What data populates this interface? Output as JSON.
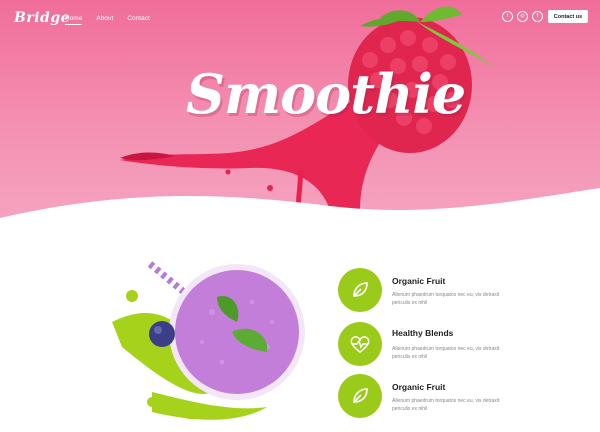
{
  "brand": {
    "logo": "Bridge"
  },
  "nav": {
    "items": [
      {
        "label": "Home",
        "active": true
      },
      {
        "label": "About",
        "active": false
      },
      {
        "label": "Contact",
        "active": false
      }
    ]
  },
  "social": [
    {
      "icon": "twitter-icon",
      "glyph": "t"
    },
    {
      "icon": "instagram-icon",
      "glyph": "◎"
    },
    {
      "icon": "facebook-icon",
      "glyph": "f"
    }
  ],
  "header": {
    "contact_button": "Contact us"
  },
  "hero": {
    "title": "Smoothie"
  },
  "features": [
    {
      "icon": "leaf-icon",
      "title": "Organic Fruit",
      "text": "Allenum phaedrum torquatos nec eu, vis detraxit periculis ex nihil"
    },
    {
      "icon": "heartbeat-icon",
      "title": "Healthy Blends",
      "text": "Allenum phaedrum torquatos nec eu, vis detraxit periculis ex nihil"
    },
    {
      "icon": "leaf-icon",
      "title": "Organic Fruit",
      "text": "Allenum phaedrum torquatos nec eu, vis detraxit periculis ex nihil"
    }
  ],
  "colors": {
    "pink": "#f48fb1",
    "accent_green": "#9bcb1a",
    "smoothie_purple": "#c27ed8",
    "raspberry": "#e8214f"
  }
}
